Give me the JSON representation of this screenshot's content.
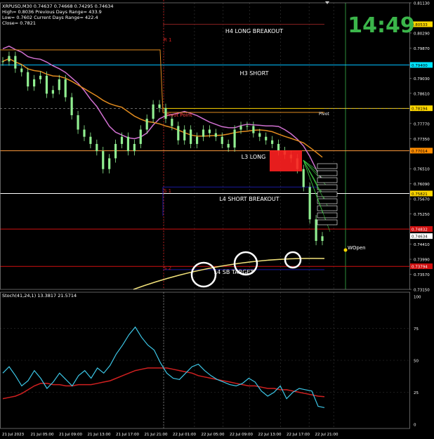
{
  "instrument": {
    "info_lines": [
      "XRPUSD,M30  0.74637 0.74668 0.74295 0.74634",
      "High= 0.8036    Previous Days Range= 433.9",
      "Low= 0.7602    Current Days Range= 422.4",
      "Close= 0.7821"
    ]
  },
  "clock": "14:49",
  "colors": {
    "background": "#000000",
    "grid": "#3a3a3a",
    "candle": "#90ee90",
    "purple_ma": "#d070d0",
    "orange_ma": "#e08a1e",
    "clock": "#3bb54a",
    "stoch_main": "#3cc6e6",
    "stoch_signal": "#d02020",
    "red_cluster": "#ff2020"
  },
  "chart_data": [
    {
      "type": "line",
      "panel": "price",
      "ylim": [
        0.7315,
        0.8113
      ],
      "y_ticks": [
        "0.81130",
        "0.80290",
        "0.79870",
        "0.79030",
        "0.78610",
        "0.77770",
        "0.77350",
        "0.76510",
        "0.76090",
        "0.75670",
        "0.75250",
        "0.74410",
        "0.73990",
        "0.73570",
        "0.73150"
      ],
      "x_ticks": [
        "21 Jul 2023",
        "21 Jul 05:00",
        "21 Jul 09:00",
        "21 Jul 13:00",
        "21 Jul 17:00",
        "21 Jul 21:00",
        "22 Jul 01:00",
        "22 Jul 05:00",
        "22 Jul 09:00",
        "22 Jul 13:00",
        "22 Jul 17:00",
        "22 Jul 21:00"
      ],
      "price_badges": [
        {
          "value": "0.80533",
          "bg": "#ffd700",
          "fg": "#000"
        },
        {
          "value": "0.79400",
          "bg": "#00e5ff",
          "fg": "#000"
        },
        {
          "value": "0.78194",
          "bg": "#ffd700",
          "fg": "#000"
        },
        {
          "value": "0.77014",
          "bg": "#ff8c00",
          "fg": "#000"
        },
        {
          "value": "0.75821",
          "bg": "#ffd700",
          "fg": "#000"
        },
        {
          "value": "0.74832",
          "bg": "#d01010",
          "fg": "#fff"
        },
        {
          "value": "0.74634",
          "bg": "#ffffff",
          "fg": "#000"
        },
        {
          "value": "0.73794",
          "bg": "#d01010",
          "fg": "#fff"
        }
      ],
      "levels": [
        {
          "name": "H4 LONG BREAKOUT",
          "value": 0.8053,
          "color": "#8b2020",
          "start_frac": 0.5
        },
        {
          "name": "H3 SHORT",
          "value": 0.794,
          "color": "#00bfff",
          "start_frac": 0.0
        },
        {
          "name": "Pivot",
          "value": 0.7819,
          "color": "#ffd700",
          "start_frac": 0.5
        },
        {
          "name": "L3 LONG",
          "value": 0.7701,
          "color": "#ff9a3c",
          "start_frac": 0.0
        },
        {
          "name": "L4 SHORT BREAKOUT",
          "value": 0.7582,
          "color": "#ffffff",
          "start_frac": 0.0
        },
        {
          "name": "L4 SHORT BREAKOUT TARGET",
          "value": 0.7483,
          "color": "#d01010",
          "start_frac": 0.0
        },
        {
          "name": "",
          "value": 0.7379,
          "color": "#d01010",
          "start_frac": 0.0
        }
      ],
      "markers": {
        "r1": "R 1",
        "s1": "S 1",
        "s2": "S 2",
        "pivot_point": "Pivot Point",
        "pivot": "Pivot",
        "l3_long": "L3 LONG",
        "l4_short_breakout": "L4 SHORT BREAKOUT",
        "target_text": "L4 SB TARGET",
        "h4": "H4 LONG BREAKOUT",
        "h3": "H3 SHORT",
        "wopen": "WOpen"
      },
      "series": [
        {
          "name": "",
          "kind": "close",
          "values": [
            0.795,
            0.7965,
            0.793,
            0.792,
            0.788,
            0.79,
            0.791,
            0.786,
            0.787,
            0.79,
            0.785,
            0.78,
            0.776,
            0.774,
            0.772,
            0.77,
            0.765,
            0.768,
            0.772,
            0.774,
            0.77,
            0.772,
            0.776,
            0.779,
            0.783,
            0.782,
            0.779,
            0.777,
            0.773,
            0.776,
            0.772,
            0.774,
            0.776,
            0.775,
            0.774,
            0.772,
            0.771,
            0.776,
            0.777,
            0.777,
            0.775,
            0.774,
            0.773,
            0.772,
            0.77,
            0.769,
            0.768,
            0.765,
            0.76,
            0.751,
            0.745,
            0.7463
          ]
        }
      ]
    },
    {
      "type": "line",
      "panel": "oscillator",
      "title": "Stoch(41,24,1) 13.3817 21.5714",
      "ylim": [
        0,
        100
      ],
      "y_ticks": [
        "100",
        "75",
        "50",
        "25",
        "0"
      ],
      "series": [
        {
          "name": "",
          "values": [
            40,
            45,
            38,
            30,
            34,
            42,
            36,
            28,
            33,
            40,
            35,
            30,
            38,
            42,
            36,
            44,
            40,
            46,
            55,
            62,
            70,
            76,
            68,
            62,
            58,
            48,
            40,
            36,
            35,
            40,
            45,
            47,
            42,
            38,
            35,
            33,
            31,
            30,
            32,
            36,
            33,
            26,
            22,
            25,
            30,
            20,
            25,
            28,
            27,
            26,
            14,
            13
          ]
        },
        {
          "name": "",
          "values": [
            20,
            21,
            22,
            24,
            27,
            30,
            32,
            32,
            31,
            31,
            30,
            30,
            31,
            31,
            31,
            32,
            33,
            34,
            36,
            38,
            40,
            42,
            43,
            44,
            44,
            44,
            44,
            43,
            42,
            41,
            40,
            38,
            37,
            36,
            35,
            34,
            33,
            32,
            31,
            30,
            30,
            29,
            28,
            28,
            27,
            27,
            26,
            25,
            24,
            23,
            22,
            21.6
          ]
        }
      ]
    }
  ]
}
